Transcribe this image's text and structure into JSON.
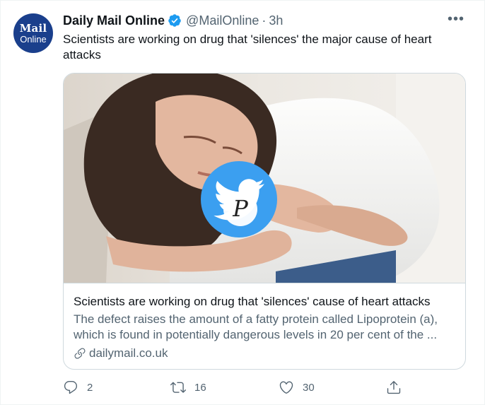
{
  "author": {
    "name": "Daily Mail Online",
    "handle": "@MailOnline",
    "separator": "·",
    "time": "3h",
    "avatar_line1": "Mail",
    "avatar_line2": "Online",
    "verified_icon": "verified-badge-icon"
  },
  "tweet": {
    "text": "Scientists are working on drug that 'silences' the major cause of heart attacks"
  },
  "card": {
    "image_icon": "twitter-bird-watermark-icon",
    "watermark_letter": "P",
    "title": "Scientists are working on drug that 'silences' cause of heart attacks",
    "description": "The defect raises the amount of a fatty protein called Lipoprotein (a), which is found in potentially dangerous levels in 20 per cent of the ...",
    "domain": "dailymail.co.uk"
  },
  "actions": {
    "reply_count": "2",
    "retweet_count": "16",
    "like_count": "30"
  },
  "colors": {
    "primary_text": "#0f1419",
    "secondary_text": "#536471",
    "verified_blue": "#1d9bf0",
    "border": "#cfd9de",
    "avatar_bg": "#1a3f8c"
  }
}
